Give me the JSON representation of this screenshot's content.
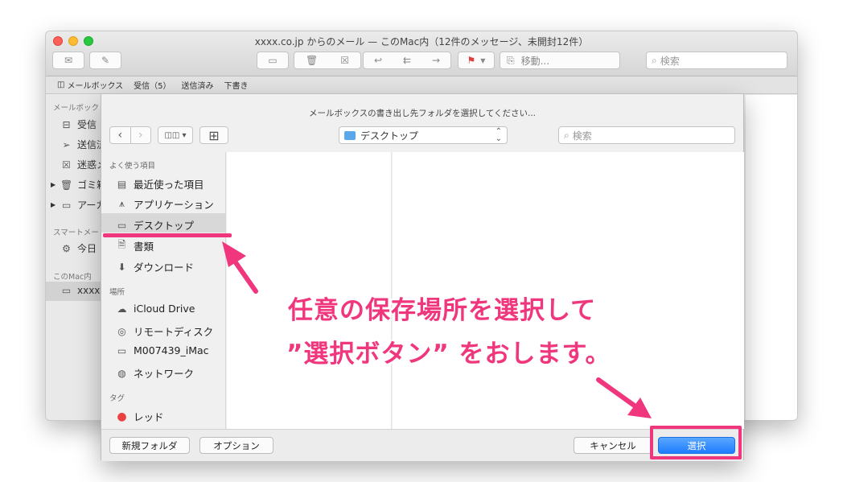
{
  "window": {
    "title": "xxxx.co.jp からのメール — このMac内（12件のメッセージ、未開封12件）",
    "search_placeholder": "検索",
    "move_label": "移動...",
    "favorites": {
      "mailboxes": "メールボックス",
      "inbox": "受信（5）",
      "sent": "送信済み",
      "drafts": "下書き"
    }
  },
  "mail_sidebar": {
    "mailboxes_header": "メールボック",
    "items": [
      "受信",
      "送信済",
      "迷惑メ",
      "ゴミ箱",
      "アーカ"
    ],
    "smart_header": "スマートメー",
    "smart_item": "今日",
    "mac_header": "このMac内",
    "mac_item": "xxxx"
  },
  "dialog": {
    "message": "メールボックスの書き出し先フォルダを選択してください...",
    "location": "デスクトップ",
    "search_placeholder": "検索",
    "favorites_header": "よく使う項目",
    "favorites": [
      "最近使った項目",
      "アプリケーション",
      "デスクトップ",
      "書類",
      "ダウンロード"
    ],
    "places_header": "場所",
    "places": [
      "iCloud Drive",
      "リモートディスク",
      "M007439_iMac",
      "ネットワーク"
    ],
    "tags_header": "タグ",
    "tags": [
      "レッド"
    ],
    "new_folder": "新規フォルダ",
    "options": "オプション",
    "cancel": "キャンセル",
    "select": "選択"
  },
  "annotation": {
    "line1": "任意の保存場所を選択して",
    "line2": "”選択ボタン” をおします。",
    "color": "#f0367d"
  }
}
